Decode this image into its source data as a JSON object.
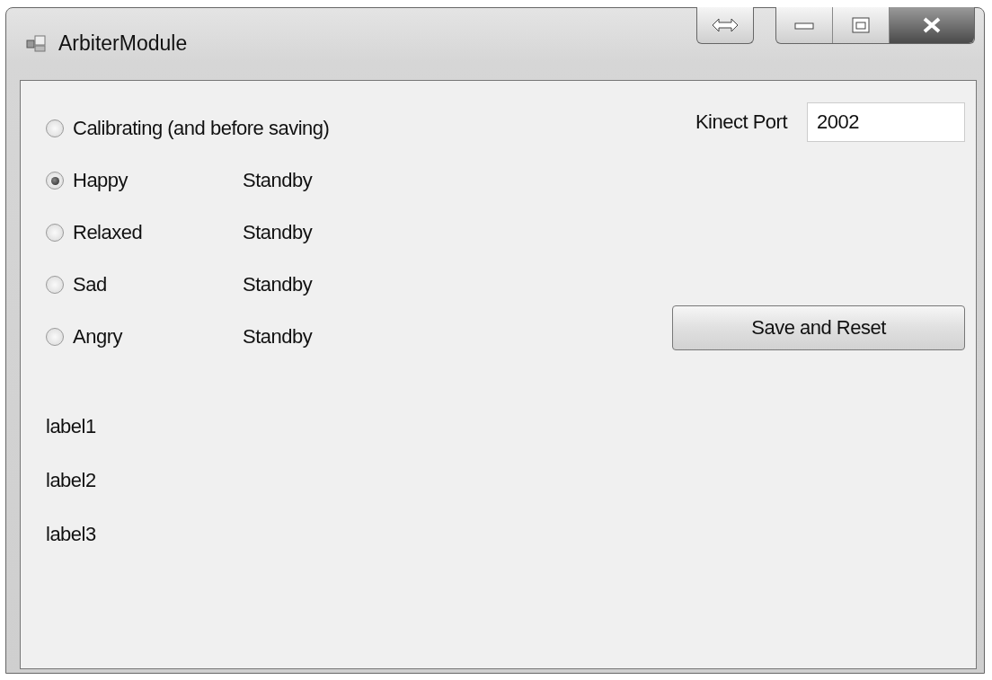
{
  "window": {
    "title": "ArbiterModule"
  },
  "modes": [
    {
      "label": "Calibrating (and before saving)",
      "selected": false
    },
    {
      "label": "Happy",
      "status": "Standby",
      "selected": true
    },
    {
      "label": "Relaxed",
      "status": "Standby",
      "selected": false
    },
    {
      "label": "Sad",
      "status": "Standby",
      "selected": false
    },
    {
      "label": "Angry",
      "status": "Standby",
      "selected": false
    }
  ],
  "kinect_port": {
    "label": "Kinect Port",
    "value": "2002"
  },
  "button": "Save and Reset",
  "labels": [
    "label1",
    "label2",
    "label3"
  ]
}
